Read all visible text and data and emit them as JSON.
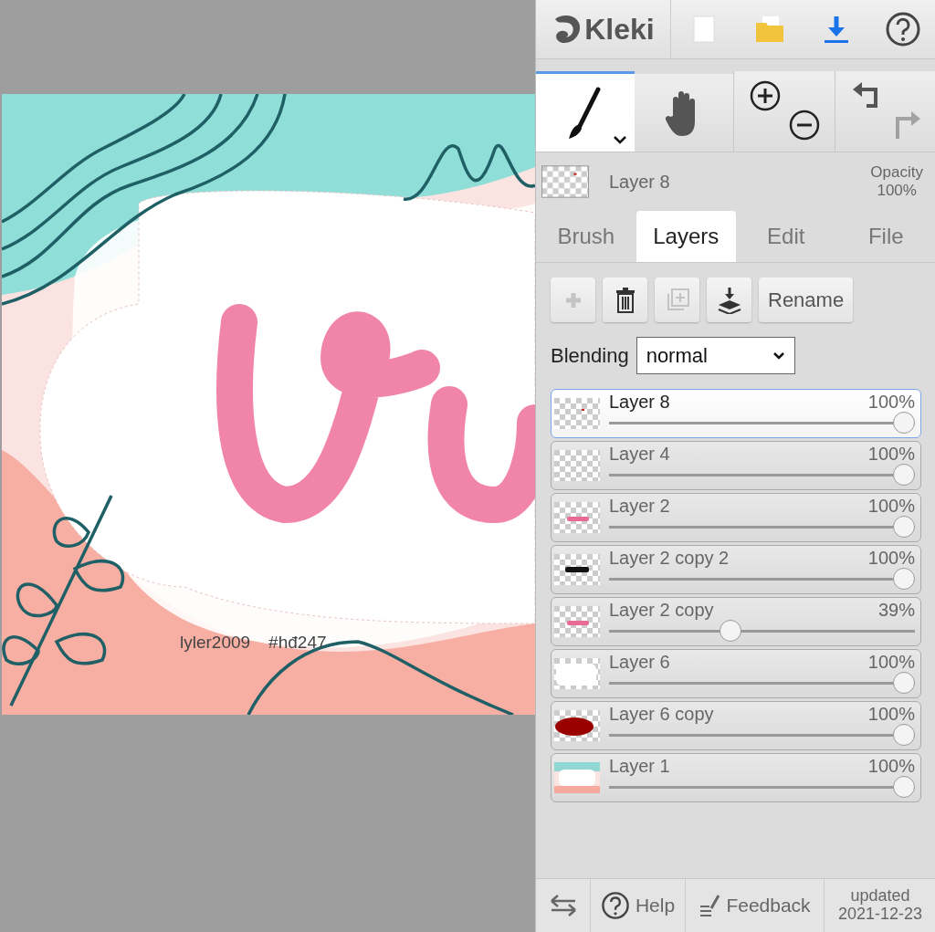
{
  "app": {
    "logo": "Kleki"
  },
  "tools": [
    {
      "kind": "brush",
      "selected": true
    },
    {
      "kind": "hand",
      "selected": false
    }
  ],
  "history": {
    "undo_disabled": false,
    "redo_disabled": true
  },
  "current_layer": {
    "name": "Layer 8",
    "opacity_label": "Opacity",
    "opacity": "100%"
  },
  "tabs": [
    {
      "label": "Brush",
      "selected": false
    },
    {
      "label": "Layers",
      "selected": true
    },
    {
      "label": "Edit",
      "selected": false
    },
    {
      "label": "File",
      "selected": false
    }
  ],
  "layer_actions": [
    {
      "kind": "add",
      "disabled": true
    },
    {
      "kind": "delete",
      "disabled": false
    },
    {
      "kind": "duplicate",
      "disabled": true
    },
    {
      "kind": "merge",
      "disabled": false
    }
  ],
  "rename_button": "Rename",
  "blending": {
    "label": "Blending",
    "value": "normal"
  },
  "layers": [
    {
      "name": "Layer 8",
      "opacity": "100%",
      "level": 1,
      "selected": true,
      "kind": "dot"
    },
    {
      "name": "Layer 4",
      "opacity": "100%",
      "level": 1,
      "selected": false,
      "kind": "empty"
    },
    {
      "name": "Layer 2",
      "opacity": "100%",
      "level": 1,
      "selected": false,
      "kind": "pink"
    },
    {
      "name": "Layer 2 copy 2",
      "opacity": "100%",
      "level": 1,
      "selected": false,
      "kind": "black"
    },
    {
      "name": "Layer 2 copy",
      "opacity": "39%",
      "level": 0.39,
      "selected": false,
      "kind": "pink"
    },
    {
      "name": "Layer 6",
      "opacity": "100%",
      "level": 1,
      "selected": false,
      "kind": "white"
    },
    {
      "name": "Layer 6 copy",
      "opacity": "100%",
      "level": 1,
      "selected": false,
      "kind": "red"
    },
    {
      "name": "Layer 1",
      "opacity": "100%",
      "level": 1,
      "selected": false,
      "kind": "scene"
    }
  ],
  "canvas": {
    "caption": [
      "lyler2009",
      "#hđ247"
    ]
  },
  "footer": {
    "help": "Help",
    "feedback": "Feedback",
    "updated": [
      "updated",
      "2021-12-23"
    ]
  }
}
